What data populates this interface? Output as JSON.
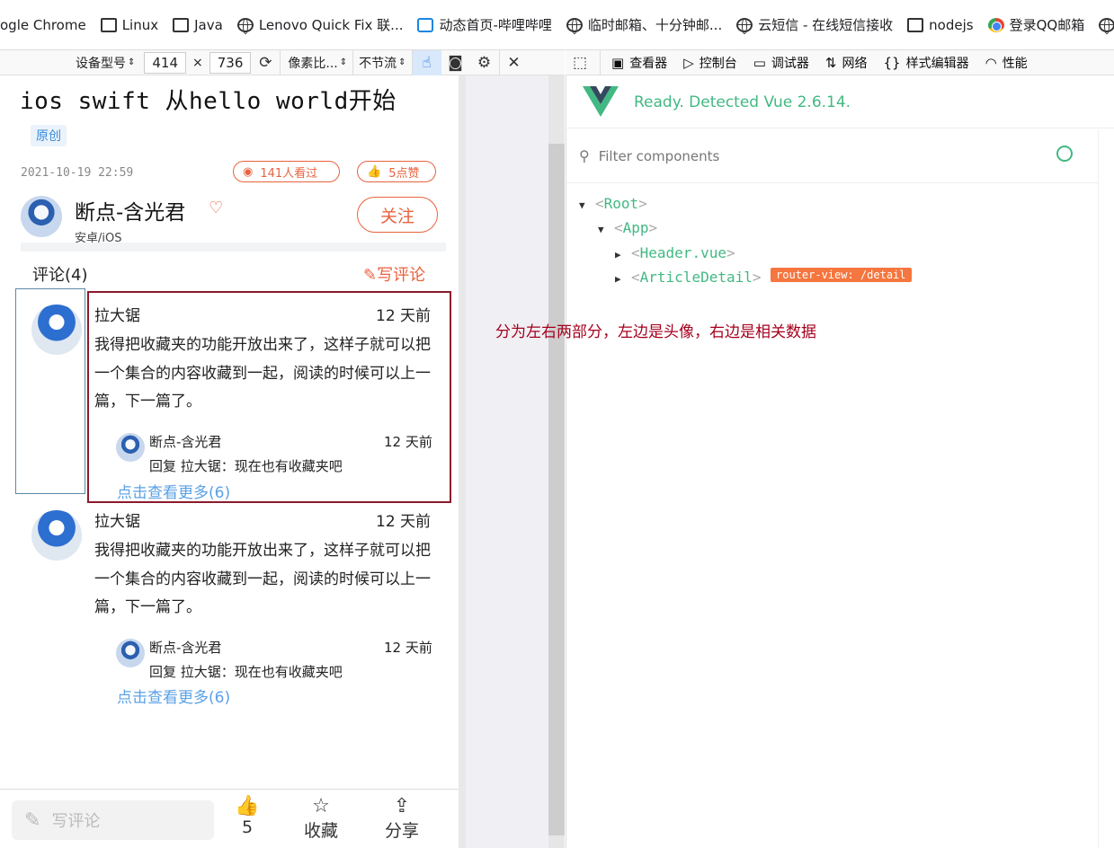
{
  "bookmarks": [
    {
      "label": "ogle Chrome",
      "icon": "none"
    },
    {
      "label": "Linux",
      "icon": "folder-icon"
    },
    {
      "label": "Java",
      "icon": "folder-icon"
    },
    {
      "label": "Lenovo Quick Fix 联...",
      "icon": "globe-icon"
    },
    {
      "label": "动态首页-哔哩哔哩",
      "icon": "bilibili-icon"
    },
    {
      "label": "临时邮箱、十分钟邮...",
      "icon": "globe-icon"
    },
    {
      "label": "云短信 - 在线短信接收",
      "icon": "globe-icon"
    },
    {
      "label": "nodejs",
      "icon": "folder-icon"
    },
    {
      "label": "登录QQ邮箱",
      "icon": "chrome-icon"
    }
  ],
  "device_toolbar": {
    "device_model": "设备型号",
    "width": "414",
    "times": "×",
    "height": "736",
    "pixel_ratio": "像素比...",
    "throttle": "不节流"
  },
  "devtools_tabs": [
    {
      "label": "查看器",
      "icon": "inspector-icon"
    },
    {
      "label": "控制台",
      "icon": "console-icon"
    },
    {
      "label": "调试器",
      "icon": "debugger-icon"
    },
    {
      "label": "网络",
      "icon": "network-icon"
    },
    {
      "label": "样式编辑器",
      "icon": "style-editor-icon"
    },
    {
      "label": "性能",
      "icon": "performance-icon"
    }
  ],
  "article": {
    "title": "ios swift 从hello world开始",
    "badge": "原创",
    "date": "2021-10-19 22:59",
    "views": "141人看过",
    "likes": "5点赞",
    "author": "断点-含光君",
    "author_tag": "安卓/iOS",
    "follow": "关注"
  },
  "comments_section": {
    "header": "评论(4)",
    "write": "写评论",
    "items": [
      {
        "name": "拉大锯",
        "time": "12 天前",
        "text": "我得把收藏夹的功能开放出来了，这样子就可以把一个集合的内容收藏到一起，阅读的时候可以上一篇，下一篇了。",
        "reply_name": "断点-含光君",
        "reply_time": "12 天前",
        "reply_text": "回复 拉大锯：现在也有收藏夹吧",
        "more": "点击查看更多(6)"
      },
      {
        "name": "拉大锯",
        "time": "12 天前",
        "text": "我得把收藏夹的功能开放出来了，这样子就可以把一个集合的内容收藏到一起，阅读的时候可以上一篇，下一篇了。",
        "reply_name": "断点-含光君",
        "reply_time": "12 天前",
        "reply_text": "回复 拉大锯：现在也有收藏夹吧",
        "more": "点击查看更多(6)"
      }
    ]
  },
  "bottom_bar": {
    "write_placeholder": "写评论",
    "like_count": "5",
    "collect": "收藏",
    "share": "分享"
  },
  "vue_devtools": {
    "status": "Ready. Detected Vue 2.6.14.",
    "filter_placeholder": "Filter components",
    "tree": {
      "root": "Root",
      "app": "App",
      "header": "Header.vue",
      "article": "ArticleDetail",
      "router_badge": "router-view: /detail"
    }
  },
  "annotation": "分为左右两部分，左边是头像，右边是相关数据",
  "colors": {
    "accent": "#e8623e",
    "link": "#5aa1e6",
    "vue_green": "#42b883",
    "annotation_red": "#a5001d"
  }
}
